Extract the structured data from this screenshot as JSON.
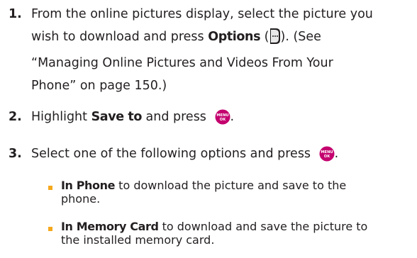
{
  "steps": [
    {
      "number": "1.",
      "line1": "From the online pictures display, select the picture you",
      "line2_pre": "wish to download and press ",
      "line2_bold": "Options",
      "line2_open": " (",
      "line2_close": "). (See",
      "line3": "“Managing Online Pictures and Videos From Your",
      "line4": "Phone” on page 150.)"
    },
    {
      "number": "2.",
      "pre": "Highlight ",
      "bold": "Save to",
      "post": " and press ",
      "end": "."
    },
    {
      "number": "3.",
      "text": "Select one of the following options and press ",
      "end": "."
    }
  ],
  "options": [
    {
      "bold": "In Phone",
      "text": " to download the picture and save to the",
      "text2": "phone."
    },
    {
      "bold": "In Memory Card",
      "text": " to download and save the picture to",
      "text2": "the installed memory card."
    }
  ],
  "icons": {
    "options_key": "right-softkey-icon",
    "menu_key": "menu-ok-key-icon",
    "menu_key_top": "MENU",
    "menu_key_bottom": "OK",
    "menu_key_color": "#c4006e",
    "bullet_color": "#f5a81c"
  }
}
